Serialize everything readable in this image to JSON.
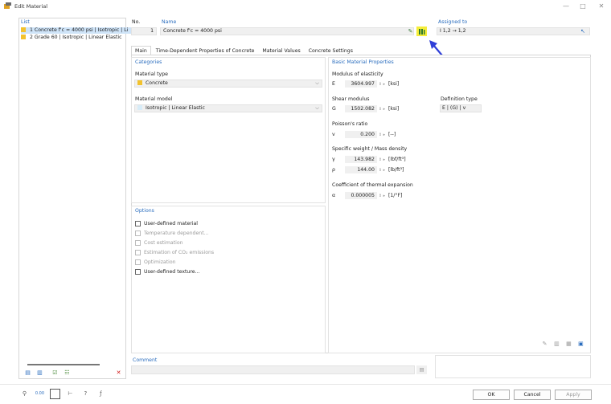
{
  "window": {
    "title": "Edit Material",
    "minimize": "—",
    "maximize": "□",
    "close": "✕"
  },
  "list": {
    "header": "List",
    "items": [
      {
        "label": "1  Concrete f'c = 4000 psi | Isotropic | Li",
        "color": "#f2c22e"
      },
      {
        "label": "2  Grade 60 | Isotropic | Linear Elastic",
        "color": "#f2c22e"
      }
    ]
  },
  "header": {
    "no_label": "No.",
    "no_value": "1",
    "name_label": "Name",
    "name_value": "Concrete f'c = 4000 psi",
    "assigned_label": "Assigned to",
    "assigned_value": "I 1,2  → 1,2"
  },
  "tabs": [
    "Main",
    "Time-Dependent Properties of Concrete",
    "Material Values",
    "Concrete Settings"
  ],
  "categories": {
    "title": "Categories",
    "material_type_label": "Material type",
    "material_type_value": "Concrete",
    "material_model_label": "Material model",
    "material_model_value": "Isotropic | Linear Elastic"
  },
  "options": {
    "title": "Options",
    "items": [
      {
        "label": "User-defined material",
        "enabled": true
      },
      {
        "label": "Temperature dependent...",
        "enabled": false
      },
      {
        "label": "Cost estimation",
        "enabled": false
      },
      {
        "label": "Estimation of CO₂ emissions",
        "enabled": false
      },
      {
        "label": "Optimization",
        "enabled": false
      },
      {
        "label": "User-defined texture...",
        "enabled": true
      }
    ]
  },
  "basic": {
    "title": "Basic Material Properties",
    "modulus_label": "Modulus of elasticity",
    "E_sym": "E",
    "E_value": "3604.997",
    "E_unit": "[ksi]",
    "shear_label": "Shear modulus",
    "G_sym": "G",
    "G_value": "1502.082",
    "G_unit": "[ksi]",
    "deftype_label": "Definition type",
    "deftype_value": "E | (G) | v",
    "poisson_label": "Poisson's ratio",
    "v_sym": "v",
    "v_value": "0.200",
    "v_unit": "[--]",
    "weight_label": "Specific weight / Mass density",
    "gamma_sym": "γ",
    "gamma_value": "143.982",
    "gamma_unit": "[lbf/ft³]",
    "rho_sym": "ρ",
    "rho_value": "144.00",
    "rho_unit": "[lb/ft³]",
    "thermal_label": "Coefficient of thermal expansion",
    "alpha_sym": "α",
    "alpha_value": "0.000005",
    "alpha_unit": "[1/°F]"
  },
  "comment": {
    "label": "Comment"
  },
  "footer": {
    "ok": "OK",
    "cancel": "Cancel",
    "apply": "Apply"
  },
  "colors": {
    "accent": "#2a6dbe",
    "concrete": "#f2c22e",
    "arrow": "#2f3fd8"
  }
}
